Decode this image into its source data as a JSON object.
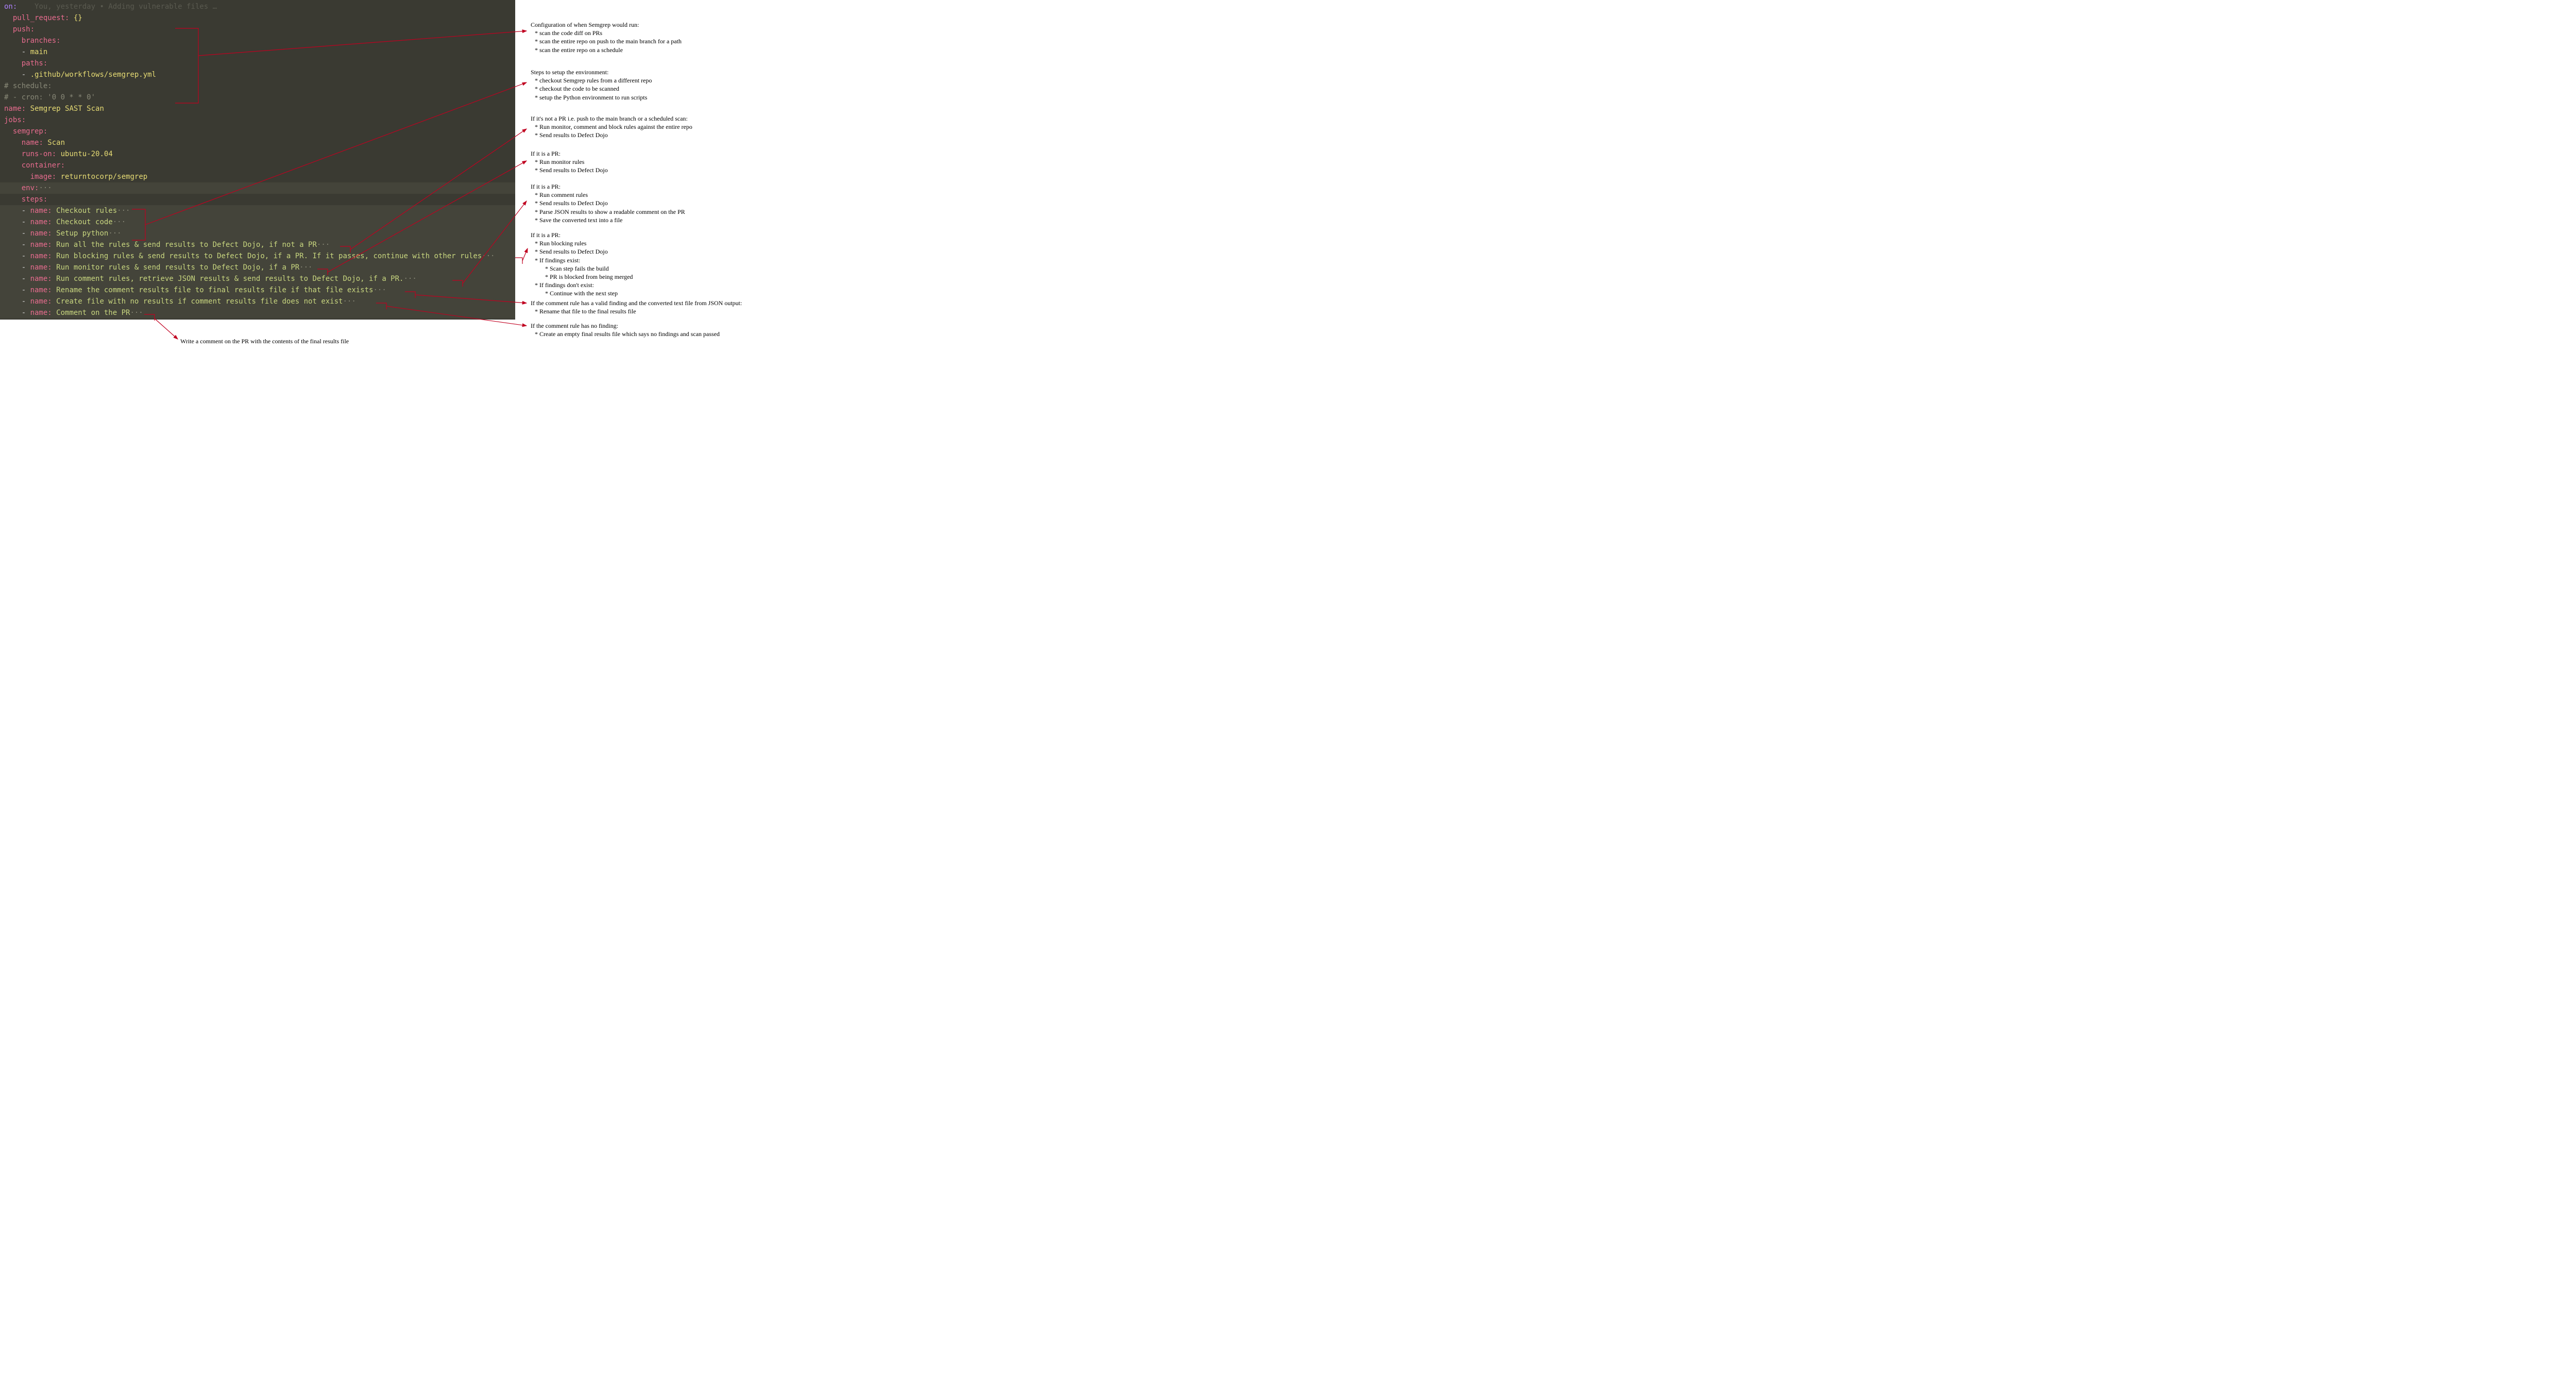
{
  "blame": "You, yesterday • Adding vulnerable files …",
  "code": {
    "on": "on",
    "colon": ":",
    "pull_request": "pull_request",
    "empty_obj": " {}",
    "push": "push",
    "branches": "branches",
    "main_dash": "- ",
    "main": "main",
    "paths": "paths",
    "path_dash": "- ",
    "path_val": ".github/workflows/semgrep.yml",
    "schedule_comment": "# schedule:",
    "cron_comment": "# - cron: '0 0 * * 0'",
    "name_key": "name",
    "name_val": " Semgrep SAST Scan",
    "jobs": "jobs",
    "semgrep": "semgrep",
    "scan_name": " Scan",
    "runs_on": "runs-on",
    "runs_on_val": " ubuntu-20.04",
    "container": "container",
    "image": "image",
    "image_val": " returntocorp/semgrep",
    "env": "env",
    "steps": "steps",
    "step_dash": "- ",
    "step_name": "name",
    "step1": " Checkout rules",
    "step2": " Checkout code",
    "step3": " Setup python",
    "step4": " Run all the rules & send results to Defect Dojo, if not a PR",
    "step5": " Run blocking rules & send results to Defect Dojo, if a PR. If it passes, continue with other rules",
    "step6": " Run monitor rules & send results to Defect Dojo, if a PR",
    "step7": " Run comment rules, retrieve JSON results & send results to Defect Dojo, if a PR.",
    "step8": " Rename the comment results file to final results file if that file exists",
    "step9": " Create file with no results if comment results file does not exist",
    "step10": " Comment on the PR",
    "dots": "···"
  },
  "notes": {
    "n1_title": "Configuration of when Semgrep would run:",
    "n1_b1": "* scan the code diff on PRs",
    "n1_b2": "* scan the entire repo on push to the main branch for a path",
    "n1_b3": "* scan the entire repo on a schedule",
    "n2_title": "Steps to setup the environment:",
    "n2_b1": "* checkout Semgrep rules from a different repo",
    "n2_b2": "* checkout the code to be scanned",
    "n2_b3": "* setup the Python environment to run scripts",
    "n3_title": "If it's not a PR i.e. push to the main branch or a scheduled scan:",
    "n3_b1": "* Run monitor, comment and block rules against the entire repo",
    "n3_b2": "* Send results to Defect Dojo",
    "n4_title": "If it is a PR:",
    "n4_b1": "* Run monitor rules",
    "n4_b2": "* Send results to Defect Dojo",
    "n5_title": "If it is a PR:",
    "n5_b1": "* Run comment rules",
    "n5_b2": "* Send results to Defect Dojo",
    "n5_b3": "* Parse JSON results to show a readable comment on the PR",
    "n5_b4": "* Save the converted text into a file",
    "n6_title": "If it is a PR:",
    "n6_b1": "* Run blocking rules",
    "n6_b2": "* Send results to Defect Dojo",
    "n6_b3": "* If findings exist:",
    "n6_s1": "* Scan step fails the build",
    "n6_s2": "* PR is blocked from being merged",
    "n6_b4": "* If findings don't exist:",
    "n6_s3": "* Continue with the next step",
    "n7_title": "If the comment rule has a valid finding and the converted text file from JSON output:",
    "n7_b1": "* Rename that file to the final results file",
    "n8_title": "If the comment rule has no finding:",
    "n8_b1": "* Create an empty final results file which says no findings and scan passed",
    "bottom": "Write a comment on the PR with the contents of the final results file"
  }
}
